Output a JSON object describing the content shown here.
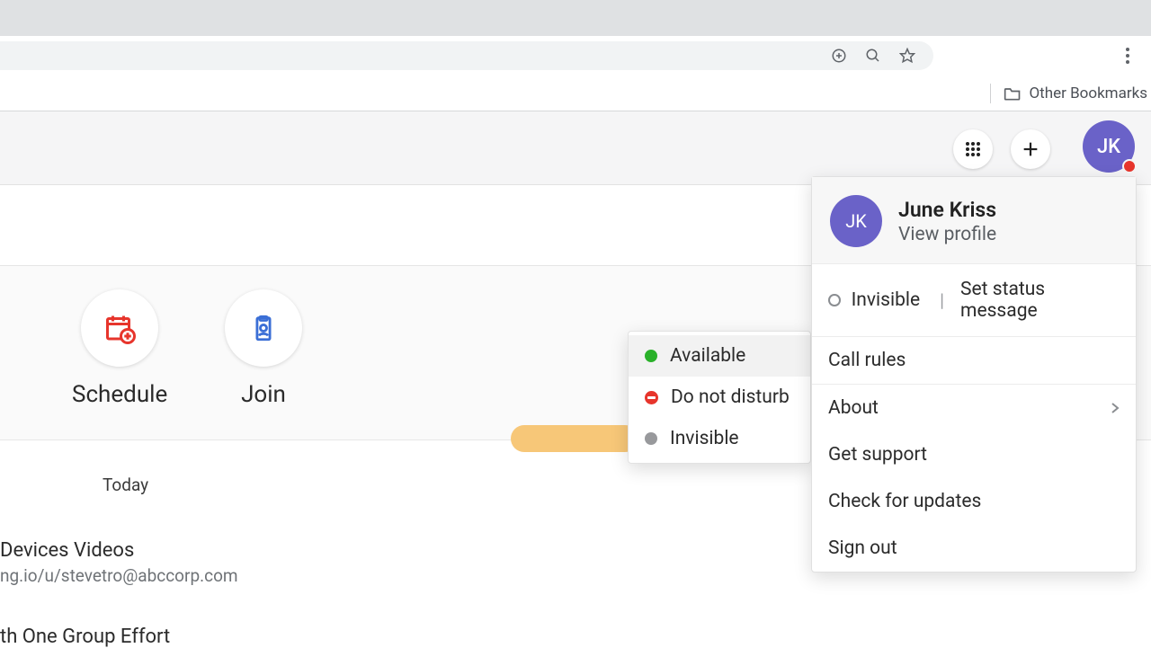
{
  "browser": {
    "other_bookmarks": "Other Bookmarks"
  },
  "header": {
    "avatar_initials": "JK"
  },
  "actions": {
    "schedule": "Schedule",
    "join": "Join"
  },
  "today_label": "Today",
  "list": {
    "item1_title": "Devices Videos",
    "item1_sub": "ng.io/u/stevetro@abccorp.com",
    "item2_title": "th One Group Effort"
  },
  "profile_menu": {
    "avatar_initials": "JK",
    "name": "June Kriss",
    "view_profile": "View profile",
    "status_label": "Invisible",
    "set_status": "Set status message",
    "call_rules": "Call rules",
    "about": "About",
    "get_support": "Get support",
    "check_updates": "Check for updates",
    "sign_out": "Sign out"
  },
  "status_menu": {
    "available": "Available",
    "dnd": "Do not disturb",
    "invisible": "Invisible"
  }
}
